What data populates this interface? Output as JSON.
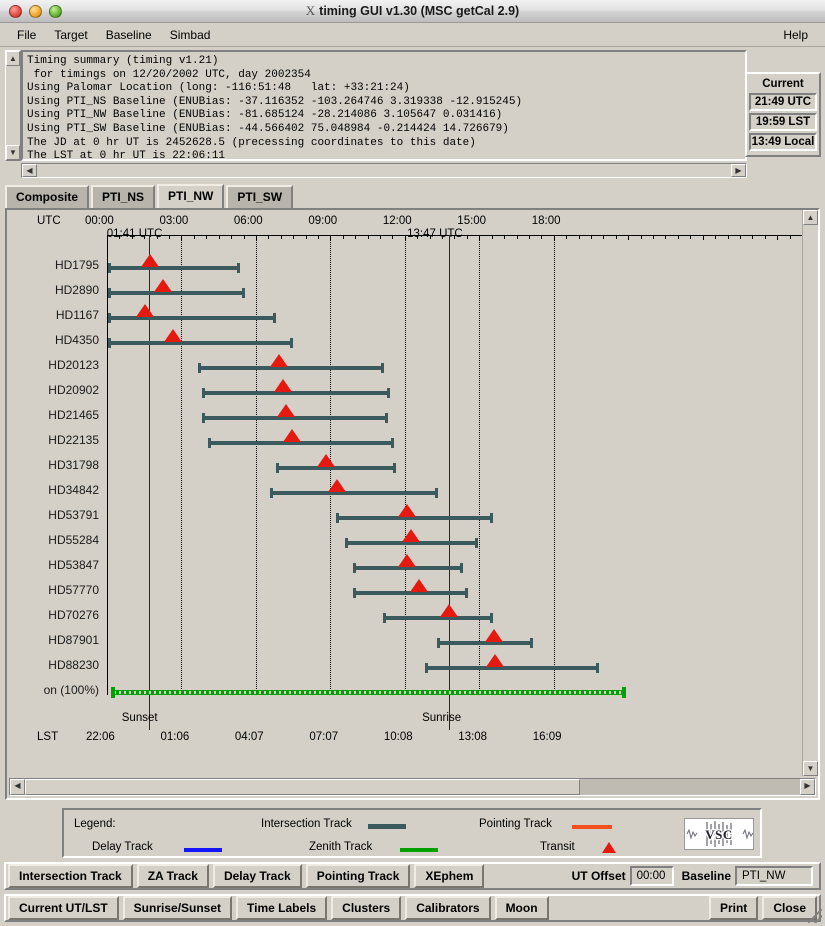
{
  "window": {
    "title": "timing GUI v1.30 (MSC getCal 2.9)",
    "x_logo": "X"
  },
  "menubar": {
    "items": [
      "File",
      "Target",
      "Baseline",
      "Simbad"
    ],
    "help": "Help"
  },
  "summary": {
    "text": "Timing summary (timing v1.21)\n for timings on 12/20/2002 UTC, day 2002354\nUsing Palomar Location (long: -116:51:48   lat: +33:21:24)\nUsing PTI_NS Baseline (ENUBias: -37.116352 -103.264746 3.319338 -12.915245)\nUsing PTI_NW Baseline (ENUBias: -81.685124 -28.214086 3.105647 0.031416)\nUsing PTI_SW Baseline (ENUBias: -44.566402 75.048984 -0.214424 14.726679)\nThe JD at 0 hr UT is 2452628.5 (precessing coordinates to this date)\nThe LST at 0 hr UT is 22:06:11"
  },
  "clocks": {
    "header": "Current",
    "utc": "21:49 UTC",
    "lst": "19:59 LST",
    "local": "13:49 Local"
  },
  "tabs": [
    {
      "label": "Composite",
      "active": false
    },
    {
      "label": "PTI_NS",
      "active": false
    },
    {
      "label": "PTI_NW",
      "active": true
    },
    {
      "label": "PTI_SW",
      "active": false
    }
  ],
  "chart_data": {
    "type": "table",
    "title": "PTI_NW observing tracks 12/20/2002",
    "xlabel_top": "UTC",
    "xlabel_bottom": "LST",
    "grid": true,
    "legend_position": "below-plot",
    "utc_ticks": [
      "00:00",
      "03:00",
      "06:00",
      "09:00",
      "12:00",
      "15:00",
      "18:00"
    ],
    "utc_tick_hours": [
      0,
      3,
      6,
      9,
      12,
      15,
      18
    ],
    "lst_ticks": [
      "22:06",
      "01:06",
      "04:07",
      "07:07",
      "10:08",
      "13:08",
      "16:09"
    ],
    "xlim_hours": [
      0,
      18
    ],
    "events": [
      {
        "label": "01:41 UTC",
        "bottom_label": "Sunset",
        "hour": 1.683
      },
      {
        "label": "13:47 UTC",
        "bottom_label": "Sunrise",
        "hour": 13.783
      }
    ],
    "rows": [
      {
        "name": "HD1795",
        "start": -1.0,
        "end": 5.35,
        "transit": 1.75
      },
      {
        "name": "HD2890",
        "start": -1.0,
        "end": 5.55,
        "transit": 2.27
      },
      {
        "name": "HD1167",
        "start": -1.0,
        "end": 6.8,
        "transit": 1.55
      },
      {
        "name": "HD4350",
        "start": -1.0,
        "end": 7.5,
        "transit": 2.64
      },
      {
        "name": "HD20123",
        "start": 3.66,
        "end": 11.18,
        "transit": 6.91
      },
      {
        "name": "HD20902",
        "start": 3.84,
        "end": 11.42,
        "transit": 7.08
      },
      {
        "name": "HD21465",
        "start": 3.84,
        "end": 11.34,
        "transit": 7.22
      },
      {
        "name": "HD22135",
        "start": 4.06,
        "end": 11.55,
        "transit": 7.45
      },
      {
        "name": "HD31798",
        "start": 6.82,
        "end": 11.64,
        "transit": 8.83
      },
      {
        "name": "HD34842",
        "start": 6.55,
        "end": 13.35,
        "transit": 9.28
      },
      {
        "name": "HD53791",
        "start": 9.24,
        "end": 15.55,
        "transit": 12.1
      },
      {
        "name": "HD55284",
        "start": 9.58,
        "end": 14.96,
        "transit": 12.23
      },
      {
        "name": "HD53847",
        "start": 9.9,
        "end": 14.35,
        "transit": 12.1
      },
      {
        "name": "HD57770",
        "start": 9.9,
        "end": 14.56,
        "transit": 12.56
      },
      {
        "name": "HD70276",
        "start": 11.1,
        "end": 15.55,
        "transit": 13.77
      },
      {
        "name": "HD87901",
        "start": 13.3,
        "end": 17.18,
        "transit": 15.6
      },
      {
        "name": "HD88230",
        "start": 12.8,
        "end": 19.82,
        "transit": 15.62
      }
    ],
    "moon_row": {
      "name": "on (100%)",
      "full_name": "Moon (100%)",
      "start": -0.75,
      "end": 20.9
    }
  },
  "legend": {
    "title": "Legend:",
    "entries": [
      {
        "label": "Intersection Track",
        "kind": "line",
        "color": "#3a5a5e"
      },
      {
        "label": "Pointing Track",
        "kind": "line",
        "color": "#f4501e"
      },
      {
        "label": "Delay Track",
        "kind": "line",
        "color": "#1414ff"
      },
      {
        "label": "Zenith Track",
        "kind": "line",
        "color": "#00a000"
      },
      {
        "label": "Transit",
        "kind": "triangle",
        "color": "#e41a10"
      }
    ],
    "logo_text": "VSC"
  },
  "toolbar_row1": {
    "buttons": [
      "Intersection Track",
      "ZA Track",
      "Delay Track",
      "Pointing Track",
      "XEphem"
    ],
    "ut_offset_label": "UT Offset",
    "ut_offset_value": "00:00",
    "baseline_label": "Baseline",
    "baseline_value": "PTI_NW"
  },
  "toolbar_row2": {
    "buttons": [
      "Current UT/LST",
      "Sunrise/Sunset",
      "Time Labels",
      "Clusters",
      "Calibrators",
      "Moon"
    ],
    "right_buttons": [
      "Print",
      "Close"
    ]
  },
  "scrollbars": {
    "up": "▲",
    "down": "▼",
    "left": "◀",
    "right": "▶"
  }
}
